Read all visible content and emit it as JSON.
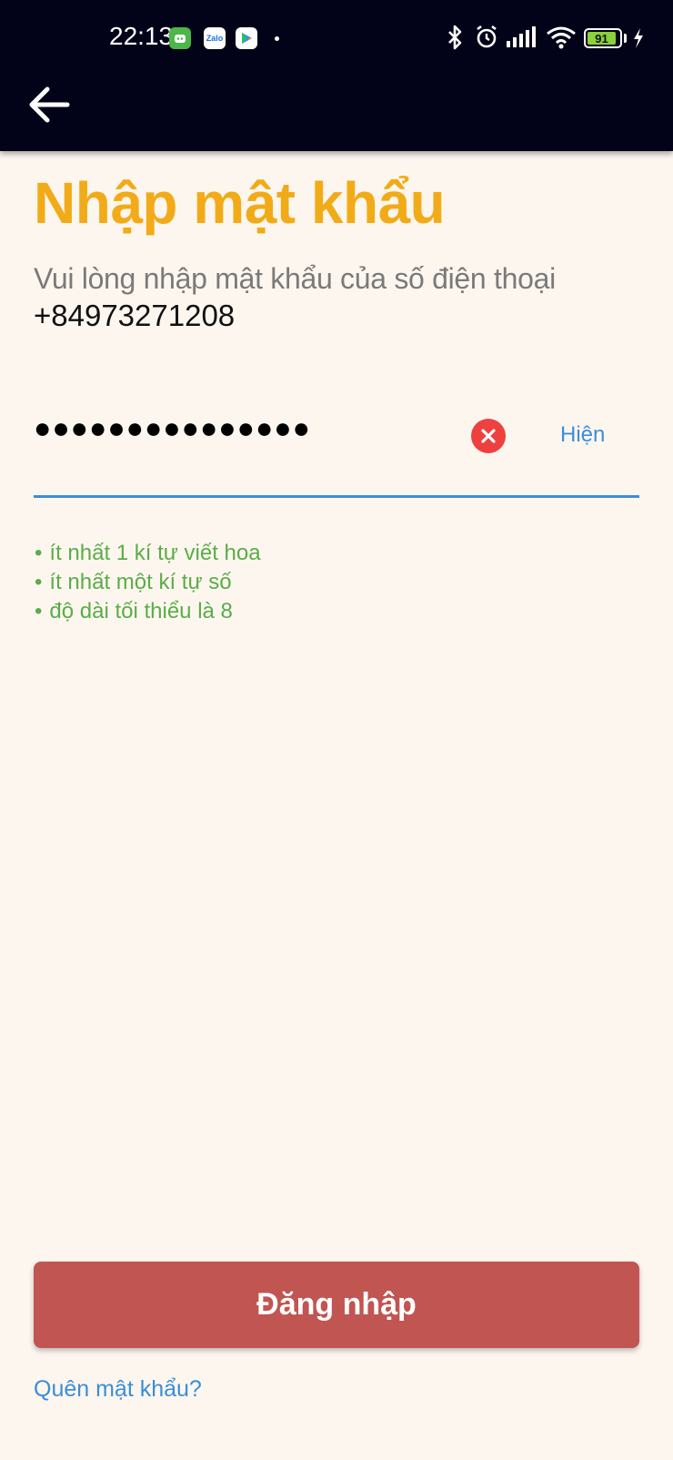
{
  "status_bar": {
    "time": "22:13",
    "app_icons": [
      "chat-bot-icon",
      "zalo-icon",
      "play-store-icon"
    ],
    "zalo_text": "Zalo",
    "battery": "91",
    "colors": {
      "battery": "#8ad13b"
    }
  },
  "header": {
    "back_icon": "arrow-left-icon"
  },
  "page": {
    "title": "Nhập mật khẩu",
    "subtitle": "Vui lòng nhập mật khẩu của số điện thoại",
    "phone": "+84973271208"
  },
  "password": {
    "masked_value": "●●●●●●●●●●●●●●●",
    "clear_icon": "clear-icon",
    "show_label": "Hiện"
  },
  "rules": [
    "ít nhất 1 kí tự viết hoa",
    "ít nhất một kí tự số",
    "độ dài tối thiểu là 8"
  ],
  "actions": {
    "login_label": "Đăng nhập",
    "forgot_label": "Quên mật khẩu?"
  },
  "colors": {
    "title": "#f2ab18",
    "accent": "#3a8ed8",
    "rules": "#5aad47",
    "button": "#c15552",
    "background": "#fdf6ef",
    "header": "#020318"
  }
}
